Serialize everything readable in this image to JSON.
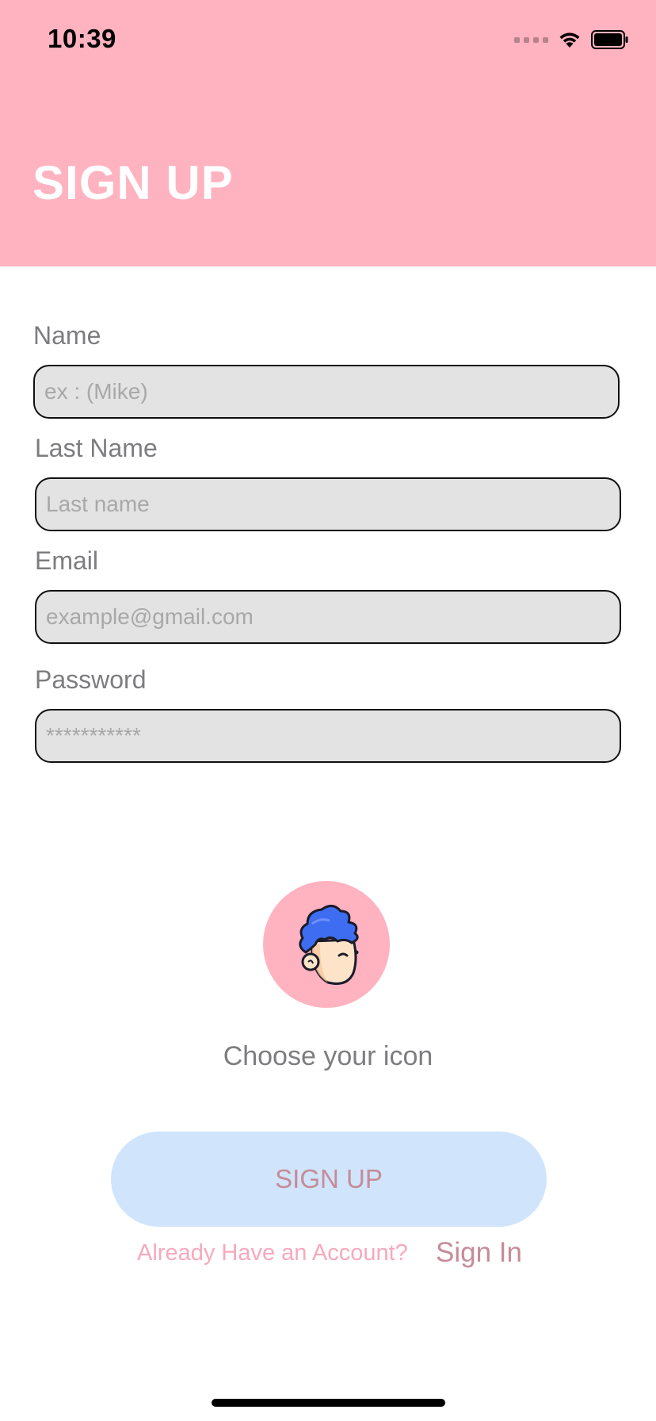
{
  "status_bar": {
    "time": "10:39"
  },
  "header": {
    "title": "SIGN UP",
    "background_color": "#ffb2bf"
  },
  "form": {
    "name": {
      "label": "Name",
      "placeholder": "ex : (Mike)",
      "value": ""
    },
    "last_name": {
      "label": "Last Name",
      "placeholder": "Last name",
      "value": ""
    },
    "email": {
      "label": "Email",
      "placeholder": "example@gmail.com",
      "value": ""
    },
    "password": {
      "label": "Password",
      "placeholder": "***********",
      "value": ""
    }
  },
  "avatar": {
    "icon": "cartoon-boy-avatar-icon",
    "caption": "Choose your icon"
  },
  "actions": {
    "signup_label": "SIGN UP",
    "already_text": "Already Have an Account?",
    "signin_label": "Sign In"
  },
  "colors": {
    "accent_pink": "#ffb2bf",
    "button_blue": "#d0e5fc",
    "button_text": "#c68b99"
  }
}
